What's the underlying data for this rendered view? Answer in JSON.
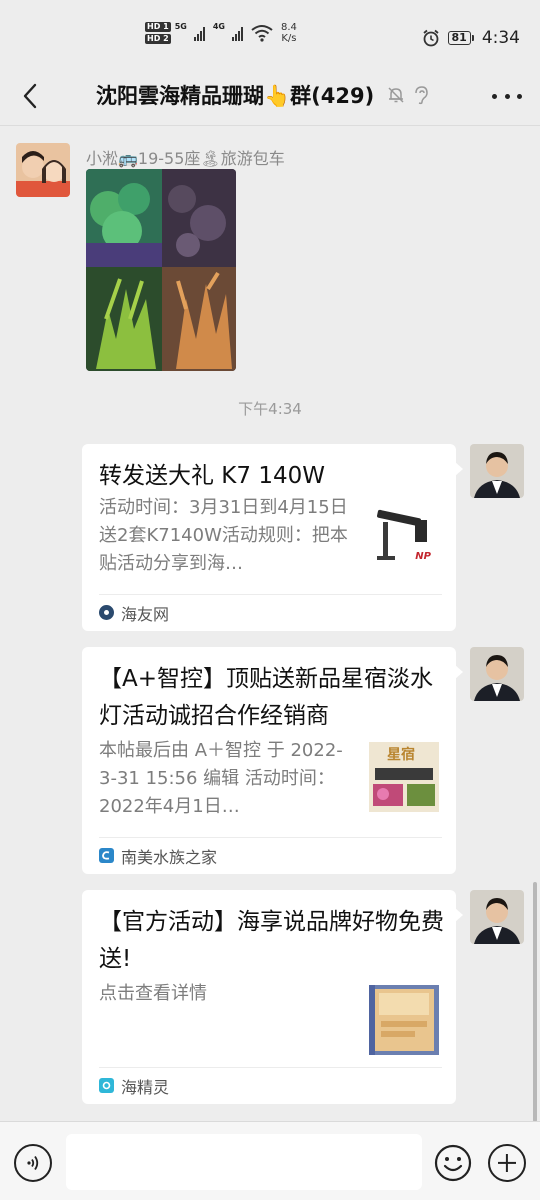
{
  "status_bar": {
    "hd1": "HD 1",
    "hd2": "HD 2",
    "net1": "5G",
    "net2": "4G",
    "speed_value": "8.4",
    "speed_unit": "K/s",
    "battery": "81",
    "time": "4:34",
    "icons": [
      "signal-icon",
      "wifi-icon",
      "alarm-icon",
      "battery-icon"
    ]
  },
  "header": {
    "title": "沈阳雲海精品珊瑚👆群(429)",
    "icons": [
      "back-icon",
      "mute-bell-icon",
      "ear-icon",
      "more-icon"
    ]
  },
  "chat": {
    "first_message": {
      "sender": "小淞🚌19-55座🏝旅游包车",
      "type": "image"
    },
    "timestamp": "下午4:34",
    "cards": [
      {
        "title": "转发送大礼 K7 140W",
        "desc": "活动时间：3月31日到4月15日送2套K7140W活动规则：把本贴活动分享到海…",
        "source": "海友网",
        "thumb_label": "NP"
      },
      {
        "title": "【A+智控】顶贴送新品星宿淡水灯活动诚招合作经销商",
        "desc": " 本帖最后由 A＋智控 于 2022-3-31 15:56 编辑 活动时间：2022年4月1日…",
        "source": "南美水族之家",
        "thumb_label": "星宿"
      },
      {
        "title": "【官方活动】海享说品牌好物免费送!",
        "desc": "点击查看详情",
        "source": "海精灵",
        "thumb_label": ""
      }
    ]
  },
  "input_bar": {
    "placeholder": "",
    "icons": [
      "voice-icon",
      "emoji-icon",
      "plus-icon"
    ]
  },
  "colors": {
    "background": "#ededed",
    "card": "#ffffff",
    "muted_text": "#7d7d7d",
    "timestamp": "#9a9a9a"
  }
}
